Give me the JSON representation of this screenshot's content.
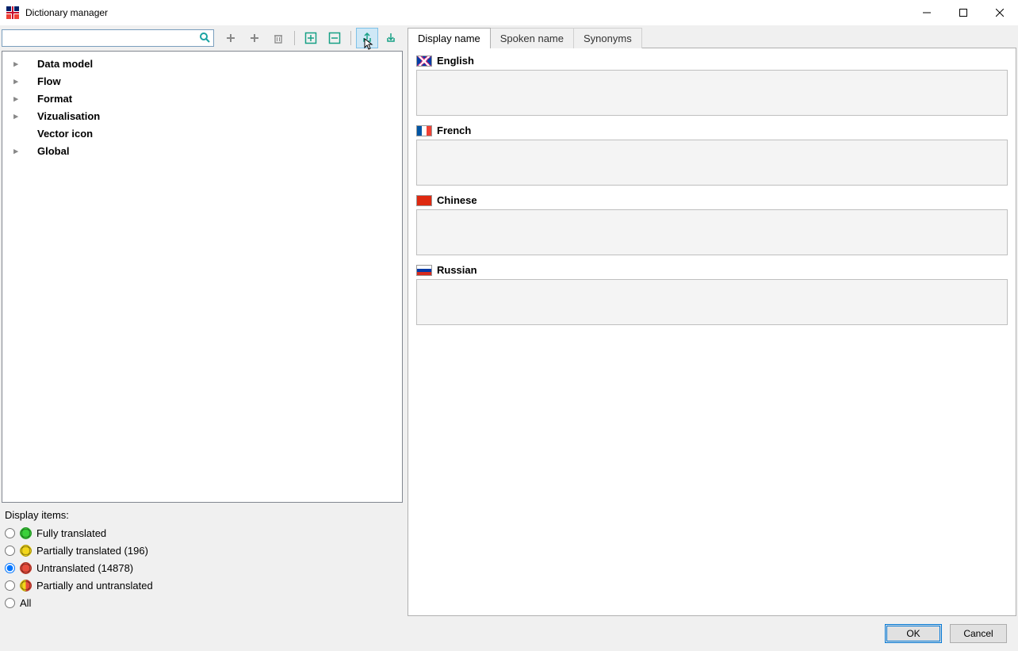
{
  "window": {
    "title": "Dictionary manager"
  },
  "search": {
    "placeholder": ""
  },
  "tree": {
    "items": [
      {
        "label": "Data model",
        "expandable": true
      },
      {
        "label": "Flow",
        "expandable": true
      },
      {
        "label": "Format",
        "expandable": true
      },
      {
        "label": "Vizualisation",
        "expandable": true
      },
      {
        "label": "Vector icon",
        "expandable": false
      },
      {
        "label": "Global",
        "expandable": true
      }
    ]
  },
  "filter": {
    "title": "Display items:",
    "options": {
      "fully": "Fully translated",
      "partially": "Partially translated (196)",
      "untranslated": "Untranslated (14878)",
      "both": "Partially and untranslated",
      "all": "All"
    },
    "selected": "untranslated"
  },
  "tabs": {
    "display_name": "Display name",
    "spoken_name": "Spoken name",
    "synonyms": "Synonyms"
  },
  "languages": {
    "english": "English",
    "french": "French",
    "chinese": "Chinese",
    "russian": "Russian"
  },
  "buttons": {
    "ok": "OK",
    "cancel": "Cancel"
  }
}
